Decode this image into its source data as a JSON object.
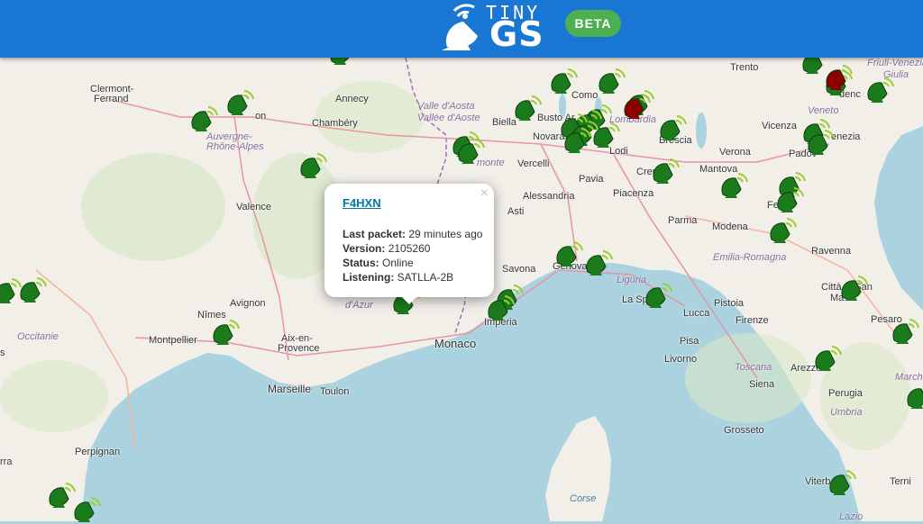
{
  "header": {
    "logo_tiny": "TINY",
    "logo_gs": "GS",
    "beta_label": "BETA"
  },
  "map": {
    "cities": [
      "Clermont-Ferrand",
      "Annecy",
      "Trento",
      "Friuli-Venezia",
      "Giulia",
      "Chambéry",
      "Aosta",
      "Vallée d'Aoste",
      "Valle d'Aosta",
      "Como",
      "Biella",
      "Busto Arsizio",
      "Novara",
      "Vercelli",
      "Lodi",
      "Brescia",
      "Vicenza",
      "Verona",
      "Padova",
      "Venezia",
      "Cremona",
      "Mantova",
      "Pavia",
      "Piacenza",
      "Alessandria",
      "Asti",
      "Parma",
      "Modena",
      "Ferrara",
      "Ravenna",
      "Valence",
      "Savona",
      "Genova",
      "Liguria",
      "La Spezia",
      "Lucca",
      "Pistoia",
      "Firenze",
      "Città di San Marino",
      "Pesaro",
      "Nîmes",
      "Avignon",
      "Montpellier",
      "Aix-en-Provence",
      "Monaco",
      "Imperia",
      "Marseille",
      "Toulon",
      "Pisa",
      "Livorno",
      "Toscana",
      "Siena",
      "Arezzo",
      "Perugia",
      "Umbria",
      "Perpignan",
      "Grosseto",
      "Corse",
      "Viterbo",
      "Lazio",
      "Lombardia",
      "Veneto",
      "Auvergne-Rhône-Alpes",
      "Occitanie",
      "Emilia-Romagna",
      "Marche",
      "Piemonte",
      "Lyon",
      "d'Azur"
    ],
    "stations_online": 62,
    "stations_offline": 2
  },
  "popup": {
    "station_name": "F4HXN",
    "close_label": "×",
    "last_packet_label": "Last packet:",
    "last_packet_value": "29 minutes ago",
    "version_label": "Version:",
    "version_value": "2105260",
    "status_label": "Status:",
    "status_value": "Online",
    "listening_label": "Listening:",
    "listening_value": "SATLLA-2B"
  },
  "colors": {
    "header": "#1976d2",
    "beta": "#4caf50",
    "station_online": "#1b7a1b",
    "station_offline": "#8b0000",
    "sea": "#aad3df",
    "land": "#f2efe9"
  }
}
